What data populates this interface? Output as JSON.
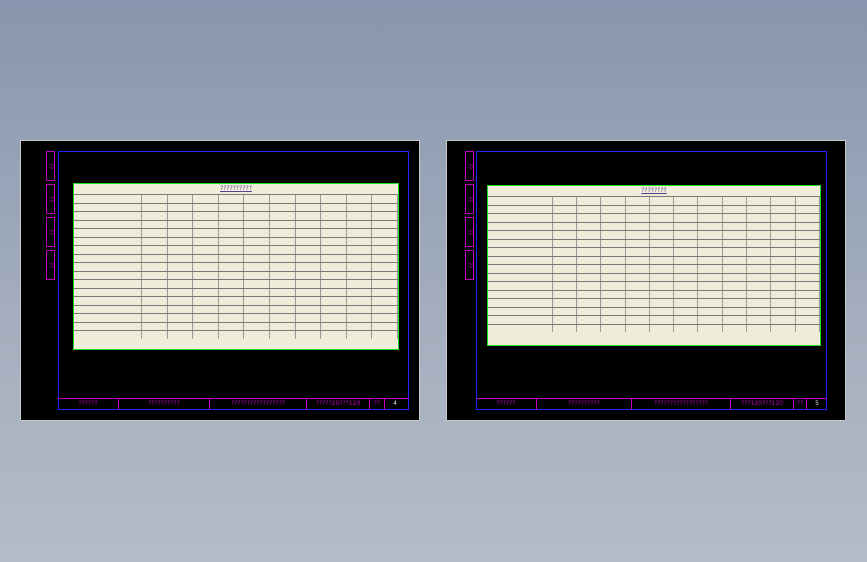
{
  "sheets": [
    {
      "id": "sheet1",
      "strip": [
        "??",
        "??",
        "??",
        "??"
      ],
      "title": "??????????",
      "titleblock": [
        "??????",
        "??????????",
        "?????????????????",
        "?????20???120",
        "??",
        "4"
      ]
    },
    {
      "id": "sheet2",
      "strip": [
        "??",
        "??",
        "??",
        "??"
      ],
      "title": "????????",
      "titleblock": [
        "??????",
        "??????????",
        "?????????????????",
        "???120???120",
        "??",
        "5"
      ]
    }
  ],
  "colors": {
    "frame": "#2323ff",
    "titleblock": "#c000c0",
    "table_border": "#22dd22",
    "table_bg": "#efedd9"
  }
}
